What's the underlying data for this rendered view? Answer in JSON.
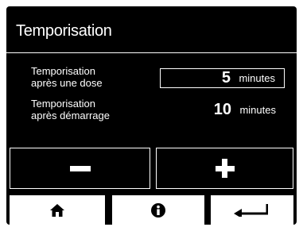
{
  "screen": {
    "title": "Temporisation"
  },
  "rows": [
    {
      "label_line1": "Temporisation",
      "label_line2": "après une dose",
      "value": "5",
      "unit": "minutes",
      "selected": true
    },
    {
      "label_line1": "Temporisation",
      "label_line2": "après démarrage",
      "value": "10",
      "unit": "minutes",
      "selected": false
    }
  ],
  "controls": {
    "decrement_icon": "minus-icon",
    "increment_icon": "plus-icon"
  },
  "nav": {
    "home_icon": "home-icon",
    "info_icon": "info-icon",
    "back_icon": "return-arrow-icon"
  },
  "colors": {
    "background": "#000000",
    "foreground": "#ffffff"
  }
}
